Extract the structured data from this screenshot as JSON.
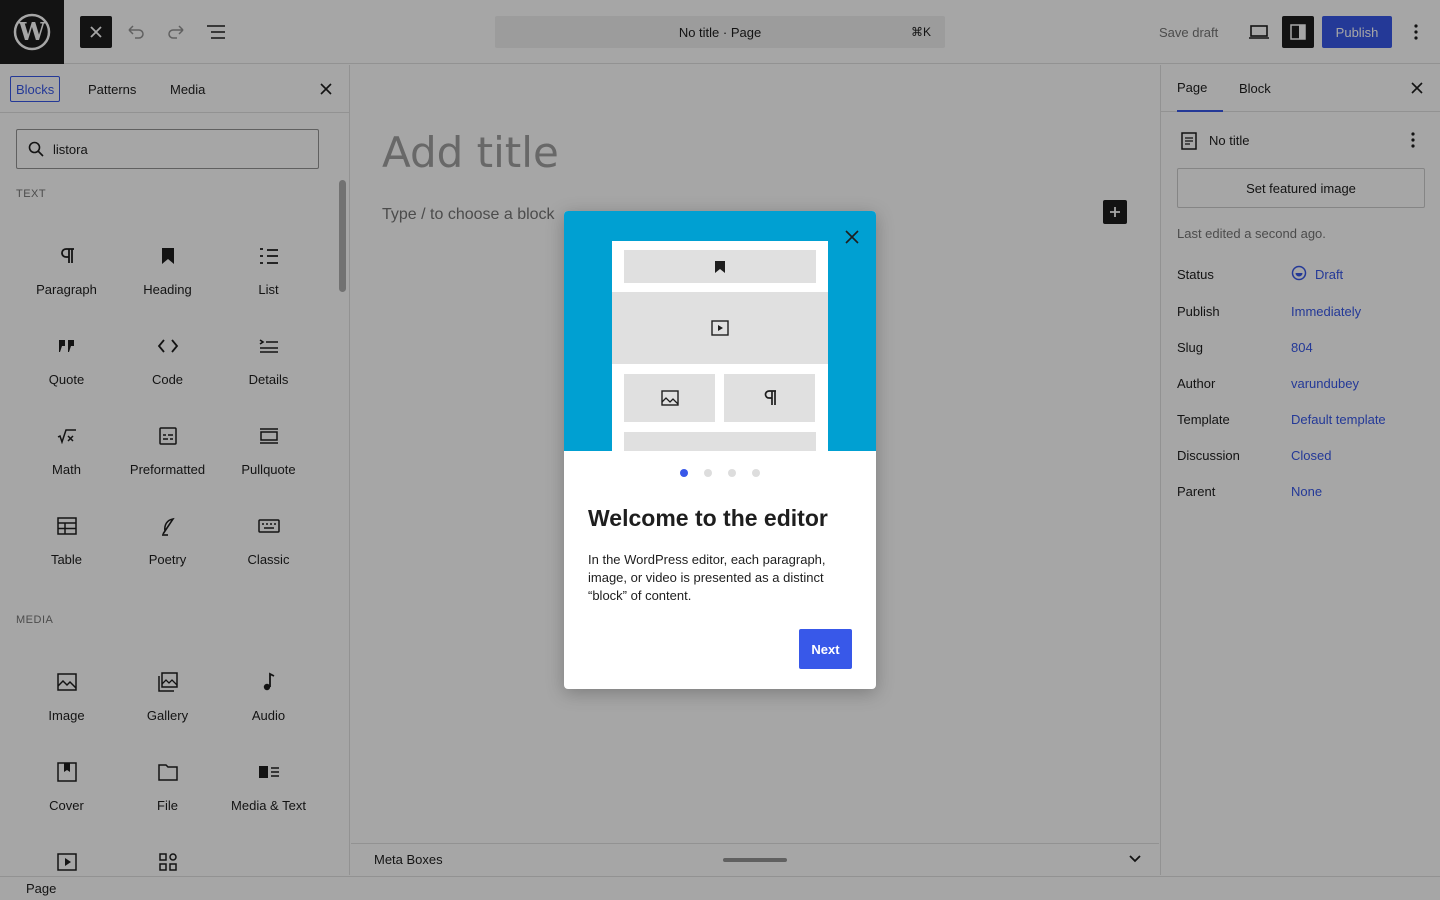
{
  "topbar": {
    "doc_title": "No title · Page",
    "shortcut": "⌘K",
    "save_draft": "Save draft",
    "publish": "Publish"
  },
  "inserter": {
    "tabs": [
      "Blocks",
      "Patterns",
      "Media"
    ],
    "search_value": "listora",
    "sections": [
      {
        "label": "TEXT",
        "items": [
          "Paragraph",
          "Heading",
          "List",
          "Quote",
          "Code",
          "Details",
          "Math",
          "Preformatted",
          "Pullquote",
          "Table",
          "Poetry",
          "Classic"
        ]
      },
      {
        "label": "MEDIA",
        "items": [
          "Image",
          "Gallery",
          "Audio",
          "Cover",
          "File",
          "Media & Text"
        ]
      }
    ]
  },
  "canvas": {
    "title_placeholder": "Add title",
    "block_hint": "Type / to choose a block",
    "metabox": "Meta Boxes"
  },
  "sidebar": {
    "tabs": [
      "Page",
      "Block"
    ],
    "doc_name": "No title",
    "featured_image": "Set featured image",
    "last_edited": "Last edited a second ago.",
    "properties": [
      {
        "label": "Status",
        "value": "Draft"
      },
      {
        "label": "Publish",
        "value": "Immediately"
      },
      {
        "label": "Slug",
        "value": "804"
      },
      {
        "label": "Author",
        "value": "varundubey"
      },
      {
        "label": "Template",
        "value": "Default template"
      },
      {
        "label": "Discussion",
        "value": "Closed"
      },
      {
        "label": "Parent",
        "value": "None"
      }
    ]
  },
  "statusbar": {
    "breadcrumb": "Page"
  },
  "modal": {
    "title": "Welcome to the editor",
    "body": "In the WordPress editor, each paragraph, image, or video is presented as a distinct “block” of content.",
    "next": "Next",
    "current_page": 1,
    "total_pages": 4
  },
  "colors": {
    "accent": "#3858e9",
    "hero": "#00a0d2"
  }
}
